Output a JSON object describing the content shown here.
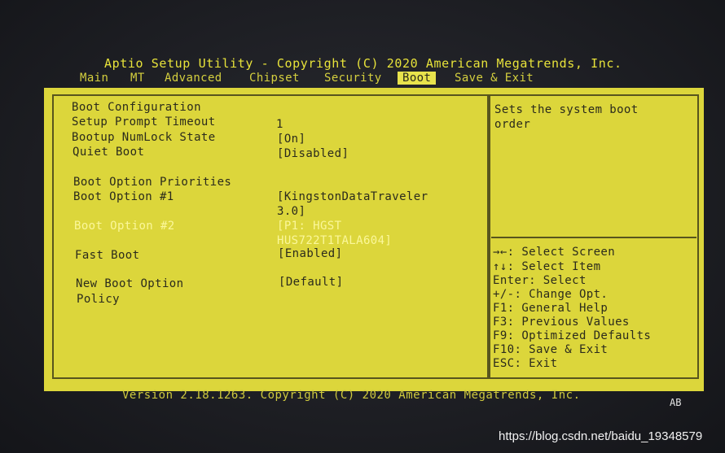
{
  "header": {
    "title": "Aptio Setup Utility - Copyright (C) 2020 American Megatrends, Inc."
  },
  "menu": {
    "tabs": [
      "Main",
      "MT",
      "Advanced",
      "Chipset",
      "Security",
      "Boot",
      "Save & Exit"
    ],
    "active_tab": "Boot"
  },
  "settings": {
    "boot_configuration_heading": "Boot Configuration",
    "setup_prompt_timeout": {
      "label": "Setup Prompt Timeout",
      "value": "1"
    },
    "bootup_numlock_state": {
      "label": "Bootup NumLock State",
      "value": "[On]"
    },
    "quiet_boot": {
      "label": "Quiet Boot",
      "value": "[Disabled]"
    },
    "boot_option_priorities_heading": "Boot Option Priorities",
    "boot_option_1": {
      "label": "Boot Option #1",
      "value_line1": "[KingstonDataTraveler",
      "value_line2": "3.0]"
    },
    "boot_option_2": {
      "label": "Boot Option #2",
      "value_line1": "[P1: HGST",
      "value_line2": "HUS722T1TALA604]"
    },
    "fast_boot": {
      "label": "Fast Boot",
      "value": "[Enabled]"
    },
    "new_boot_option_policy": {
      "label_line1": "New Boot Option",
      "label_line2": "Policy",
      "value": "[Default]"
    }
  },
  "help": {
    "description_line1": "Sets the system boot",
    "description_line2": "order",
    "keys": [
      "→←: Select Screen",
      "↑↓: Select Item",
      "Enter: Select",
      "+/-: Change Opt.",
      "F1: General Help",
      "F3: Previous Values",
      "F9: Optimized Defaults",
      "F10: Save & Exit",
      "ESC: Exit"
    ]
  },
  "footer": {
    "version_text": "Version 2.18.1263. Copyright (C) 2020 American Megatrends, Inc.",
    "ab_label": "AB"
  },
  "watermark": "https://blog.csdn.net/baidu_19348579",
  "colors": {
    "panel_background": "#dcd63b",
    "text": "#2b2b1c",
    "selected_text": "#fbf79a",
    "title_text": "#e8e33a"
  }
}
